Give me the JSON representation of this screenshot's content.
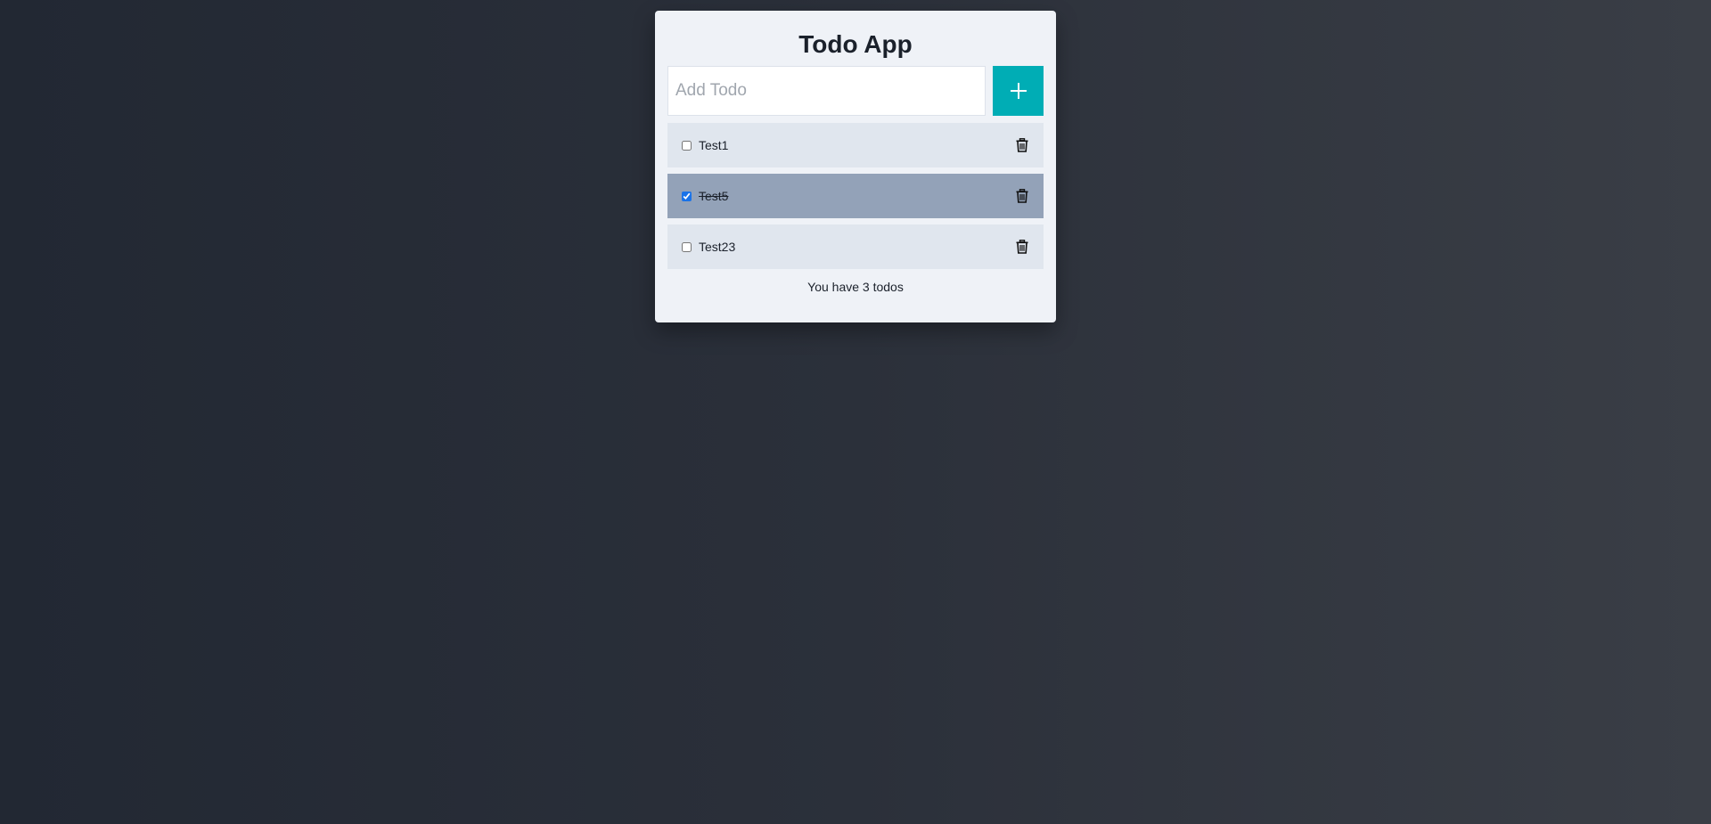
{
  "app": {
    "title": "Todo App"
  },
  "add": {
    "placeholder": "Add Todo",
    "value": "",
    "button_icon": "plus-icon"
  },
  "todos": [
    {
      "text": "Test1",
      "completed": false
    },
    {
      "text": "Test5",
      "completed": true
    },
    {
      "text": "Test23",
      "completed": false
    }
  ],
  "footer": {
    "summary": "You have 3 todos"
  },
  "icons": {
    "delete": "trash-icon",
    "add": "plus-icon"
  },
  "colors": {
    "accent": "#00adb5",
    "card_background": "#eff2f7",
    "item_background": "#e0e6ee",
    "item_done_background": "#93a2b8"
  }
}
